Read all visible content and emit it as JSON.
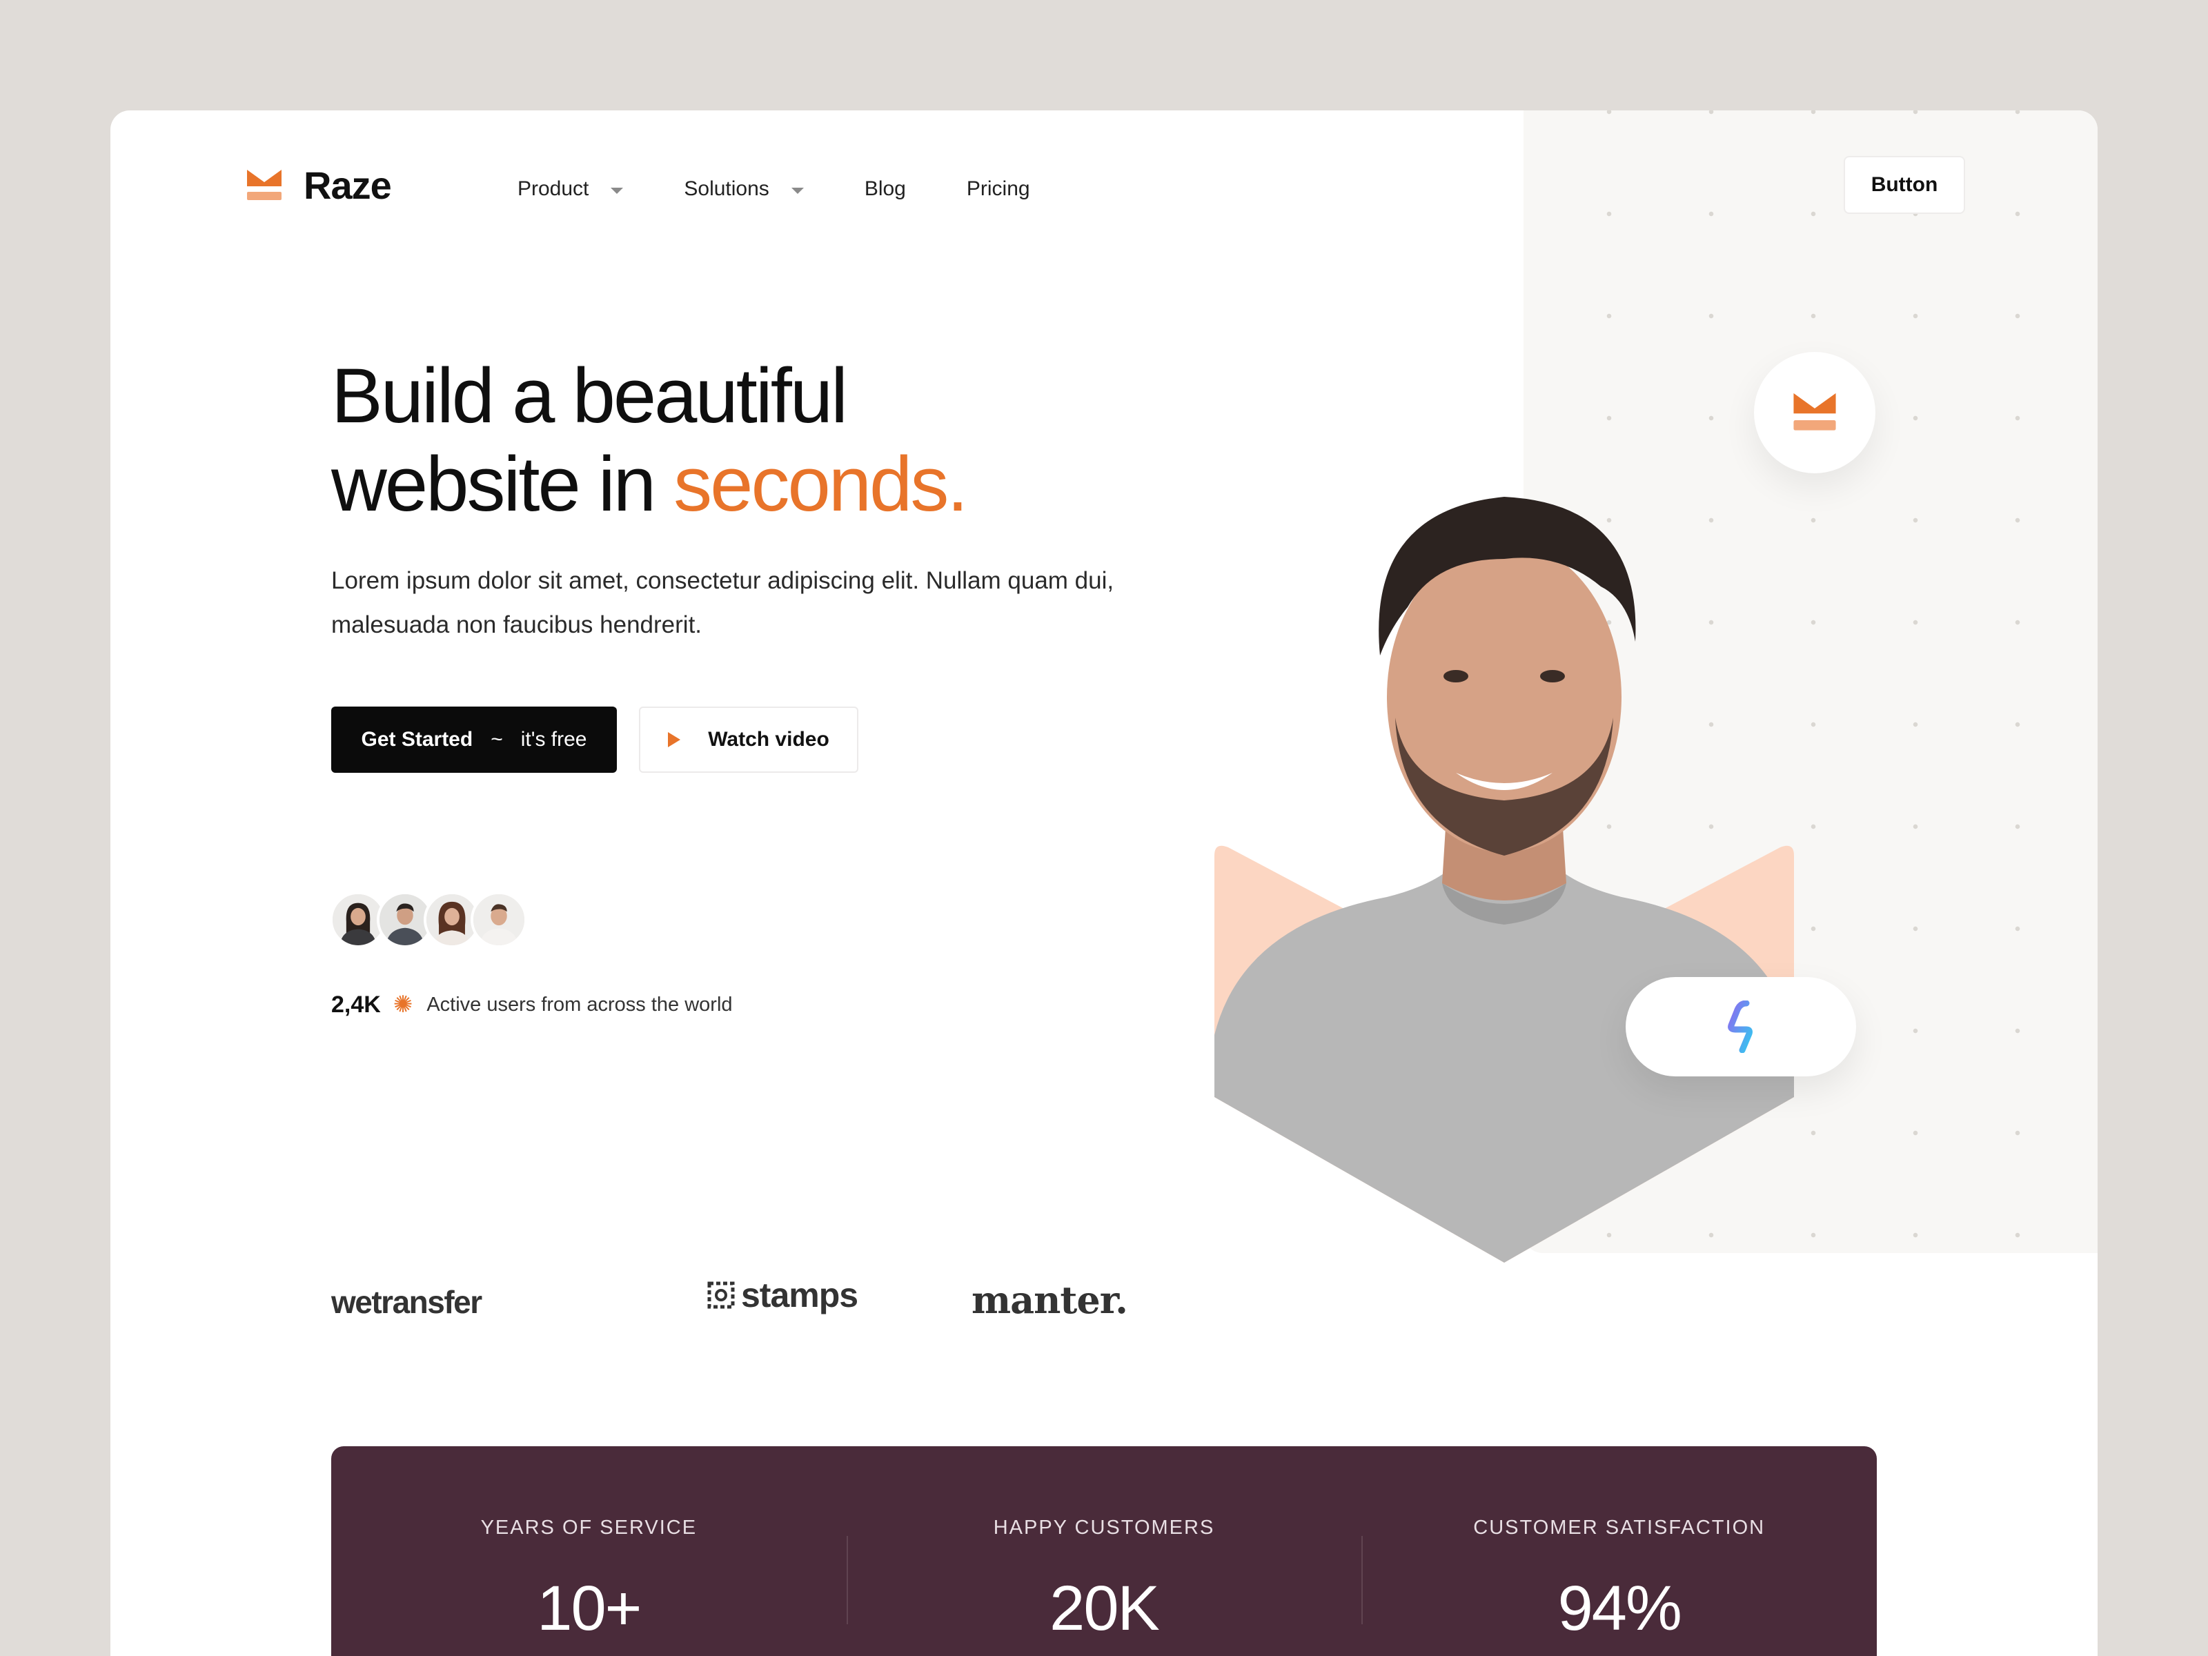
{
  "brand": {
    "name": "Raze",
    "accent_color": "#e8742a",
    "logo_icon": "chevron-bowl-icon"
  },
  "nav": {
    "items": [
      {
        "label": "Product",
        "has_dropdown": true
      },
      {
        "label": "Solutions",
        "has_dropdown": true
      },
      {
        "label": "Blog",
        "has_dropdown": false
      },
      {
        "label": "Pricing",
        "has_dropdown": false
      }
    ],
    "cta_label": "Button"
  },
  "hero": {
    "headline_line1": "Build a beautiful",
    "headline_line2_prefix": "website in ",
    "headline_line2_accent": "seconds.",
    "subtext": "Lorem ipsum dolor sit amet, consectetur adipiscing elit. Nullam quam dui, malesuada non faucibus hendrerit.",
    "primary_cta": {
      "label": "Get Started",
      "separator": "~",
      "suffix": "it's free"
    },
    "secondary_cta": {
      "label": "Watch video",
      "icon": "play-icon"
    }
  },
  "social_proof": {
    "avatars": [
      "avatar-1",
      "avatar-2",
      "avatar-3",
      "avatar-4"
    ],
    "count": "2,4K",
    "label": "Active users from across the world"
  },
  "partners": [
    "wetransfer",
    "stamps",
    "manter."
  ],
  "stats": [
    {
      "label": "YEARS OF SERVICE",
      "value": "10+"
    },
    {
      "label": "HAPPY CUSTOMERS",
      "value": "20K"
    },
    {
      "label": "CUSTOMER SATISFACTION",
      "value": "94%"
    }
  ],
  "colors": {
    "page_bg": "#e0dcd8",
    "card_bg": "#ffffff",
    "panel_bg": "#f8f7f5",
    "stats_bg": "#4a2b3a",
    "accent": "#e8742a",
    "peach": "#fcd6c2"
  }
}
